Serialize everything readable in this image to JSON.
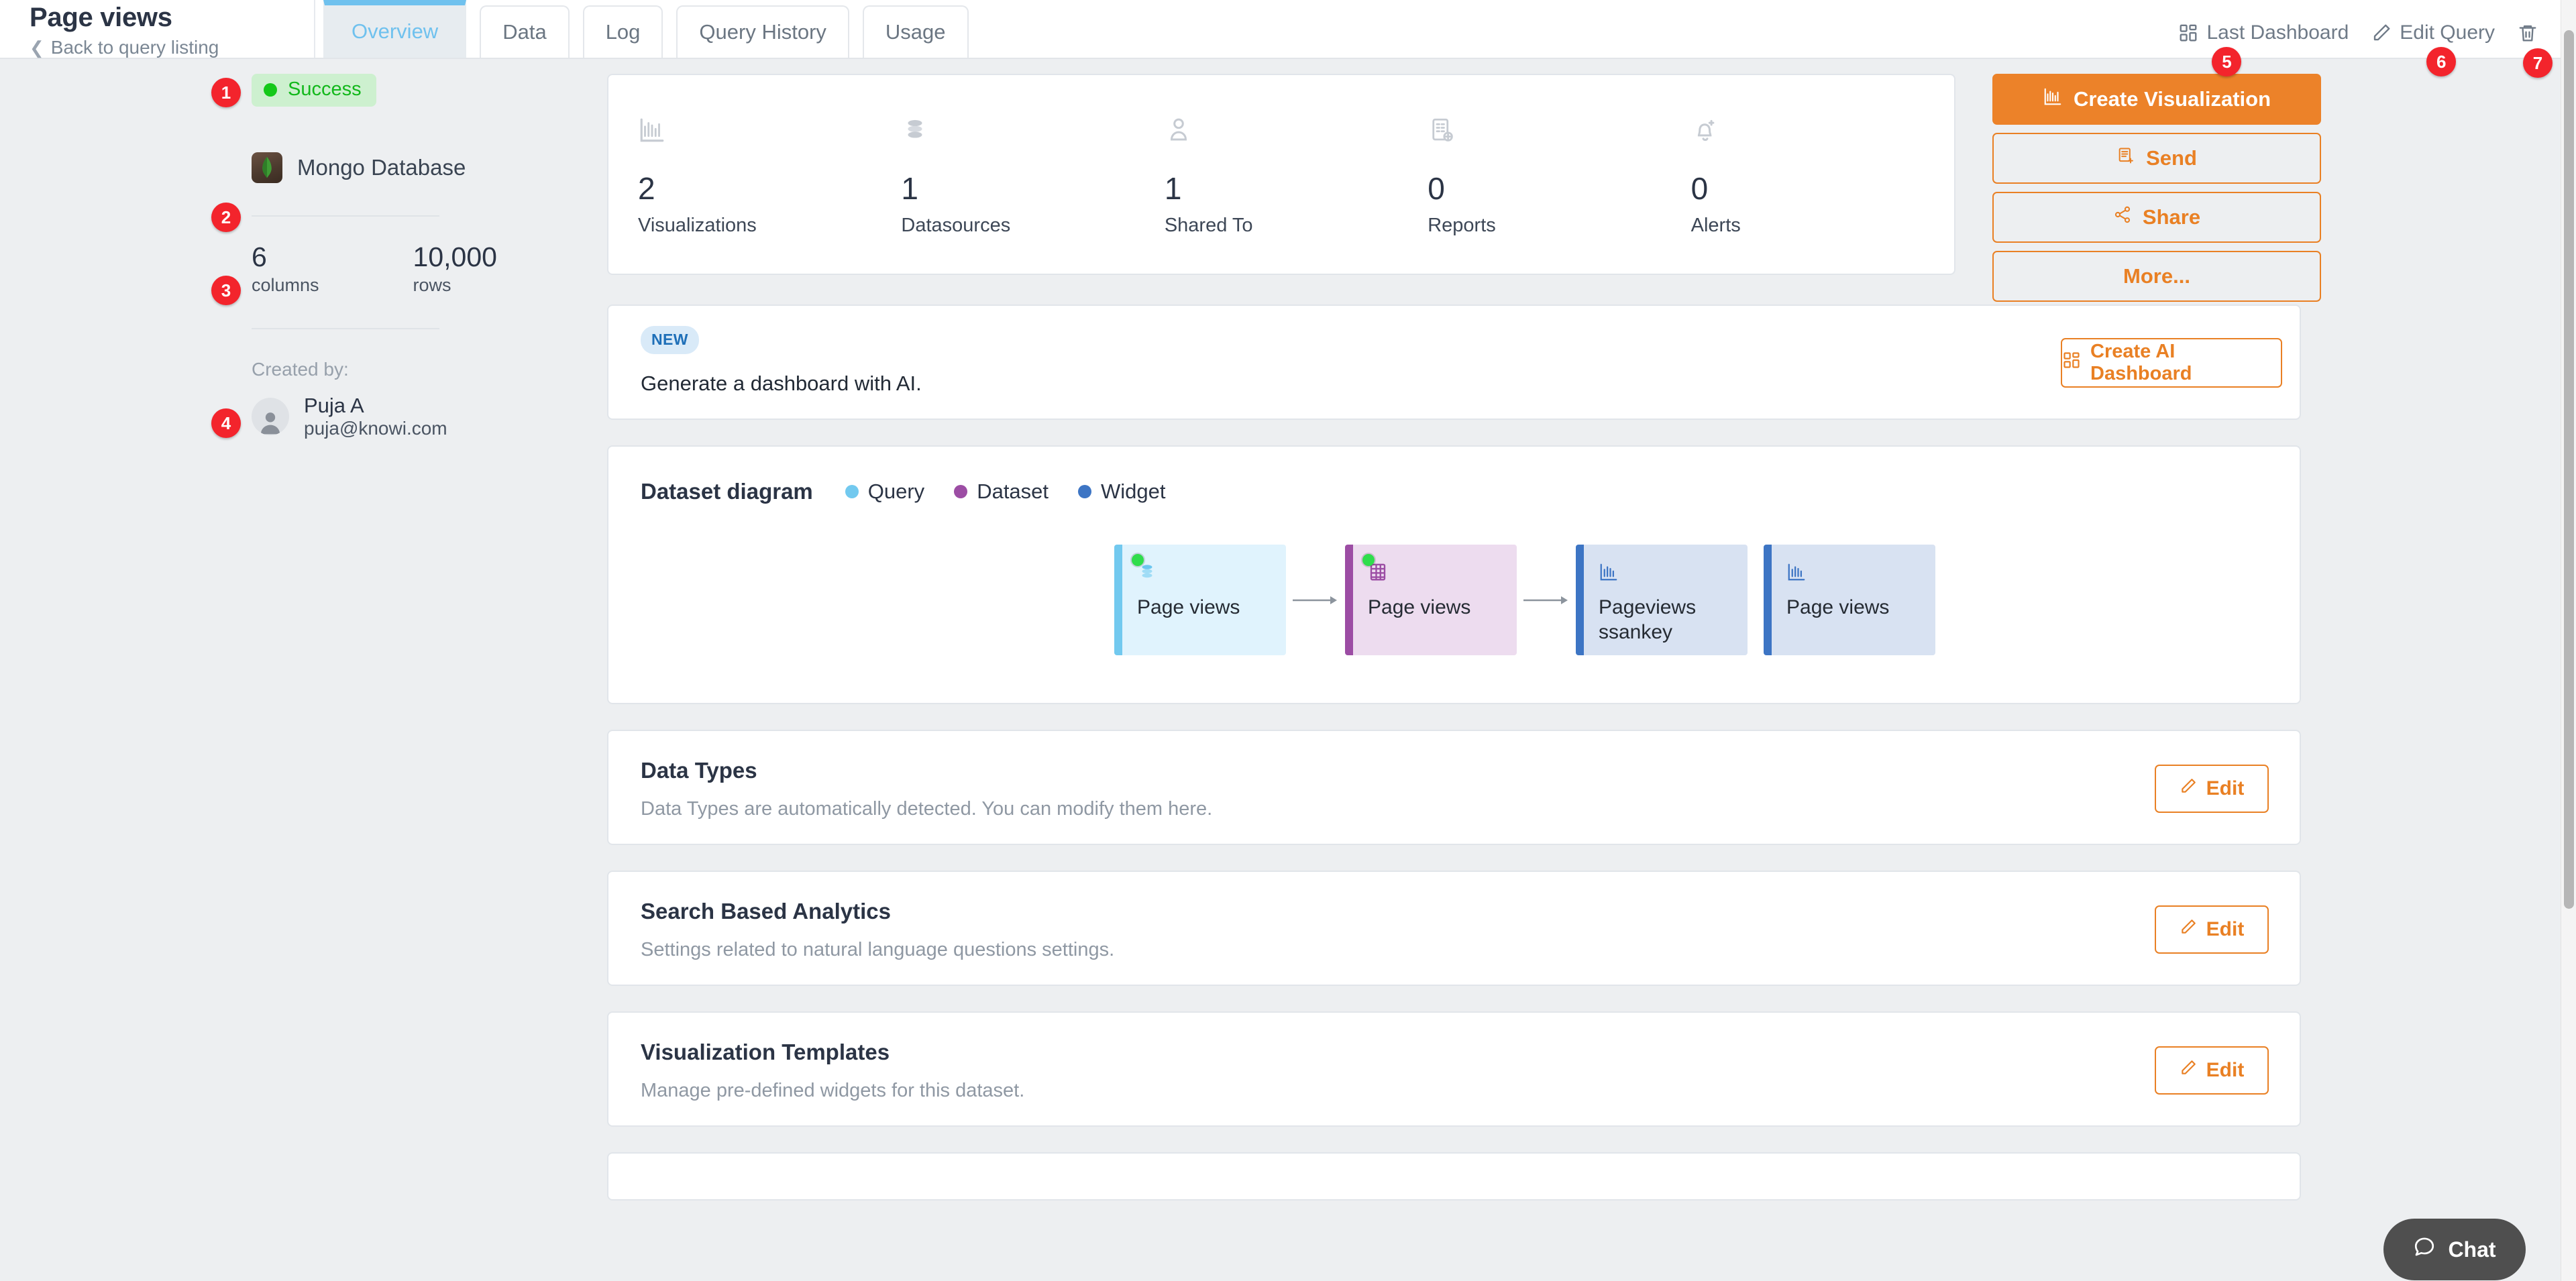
{
  "header": {
    "title": "Page views",
    "back_label": "Back to query listing",
    "back_icon": "chevron-left-icon",
    "tabs": [
      {
        "label": "Overview",
        "active": true
      },
      {
        "label": "Data",
        "active": false
      },
      {
        "label": "Log",
        "active": false
      },
      {
        "label": "Query History",
        "active": false
      },
      {
        "label": "Usage",
        "active": false
      }
    ],
    "actions": [
      {
        "label": "Last Dashboard",
        "icon": "dashboard-grid-icon",
        "badge": "5"
      },
      {
        "label": "Edit Query",
        "icon": "pencil-icon",
        "badge": "6"
      },
      {
        "label": "",
        "icon": "trash-icon",
        "badge": "7"
      }
    ]
  },
  "sidebar": {
    "status": {
      "label": "Success",
      "dot_color": "#14c919",
      "badge": "1"
    },
    "database": {
      "name": "Mongo Database",
      "icon": "mongodb-icon",
      "badge": "2"
    },
    "counts": {
      "badge": "3",
      "items": [
        {
          "value": "6",
          "label": "columns"
        },
        {
          "value": "10,000",
          "label": "rows"
        }
      ]
    },
    "created_by_label": "Created by:",
    "user": {
      "name": "Puja A",
      "email": "puja@knowi.com",
      "avatar_icon": "user-avatar-icon",
      "badge": "4"
    }
  },
  "stats": [
    {
      "value": "2",
      "label": "Visualizations",
      "icon": "bar-chart-icon"
    },
    {
      "value": "1",
      "label": "Datasources",
      "icon": "database-stack-icon"
    },
    {
      "value": "1",
      "label": "Shared To",
      "icon": "person-icon"
    },
    {
      "value": "0",
      "label": "Reports",
      "icon": "report-add-icon"
    },
    {
      "value": "0",
      "label": "Alerts",
      "icon": "bell-add-icon"
    }
  ],
  "actions_panel": [
    {
      "label": "Create Visualization",
      "icon": "bar-chart-icon",
      "style": "primary"
    },
    {
      "label": "Send",
      "icon": "send-report-icon",
      "style": "outline"
    },
    {
      "label": "Share",
      "icon": "share-nodes-icon",
      "style": "outline"
    },
    {
      "label": "More...",
      "icon": "",
      "style": "outline"
    }
  ],
  "ai_banner": {
    "pill": "NEW",
    "text": "Generate a dashboard with AI.",
    "button_label": "Create AI Dashboard",
    "button_icon": "dashboard-grid-icon"
  },
  "diagram": {
    "title": "Dataset diagram",
    "legend": [
      {
        "label": "Query",
        "color": "#72c9ef"
      },
      {
        "label": "Dataset",
        "color": "#9c4da4"
      },
      {
        "label": "Widget",
        "color": "#3d75c4"
      }
    ],
    "nodes": [
      {
        "label": "Page views",
        "type": "query",
        "icon": "database-stack-icon",
        "live": true,
        "arrow_after": true
      },
      {
        "label": "Page views",
        "type": "dataset",
        "icon": "table-grid-icon",
        "live": true,
        "arrow_after": true
      },
      {
        "label": "Pageviews ssankey",
        "type": "widget",
        "icon": "bar-chart-icon",
        "live": false,
        "arrow_after": false
      },
      {
        "label": "Page views",
        "type": "widget",
        "icon": "bar-chart-icon",
        "live": false,
        "arrow_after": false
      }
    ]
  },
  "sections": [
    {
      "title": "Data Types",
      "desc": "Data Types are automatically detected. You can modify them here.",
      "button": "Edit"
    },
    {
      "title": "Search Based Analytics",
      "desc": "Settings related to natural language questions settings.",
      "button": "Edit"
    },
    {
      "title": "Visualization Templates",
      "desc": "Manage pre-defined widgets for this dataset.",
      "button": "Edit"
    }
  ],
  "chat": {
    "label": "Chat",
    "icon": "chat-bubble-icon"
  },
  "colors": {
    "accent": "#e98024",
    "primary": "#ec8229",
    "tab_active": "#6fc1ee",
    "badge": "#f3242c",
    "success": "#14c919"
  }
}
